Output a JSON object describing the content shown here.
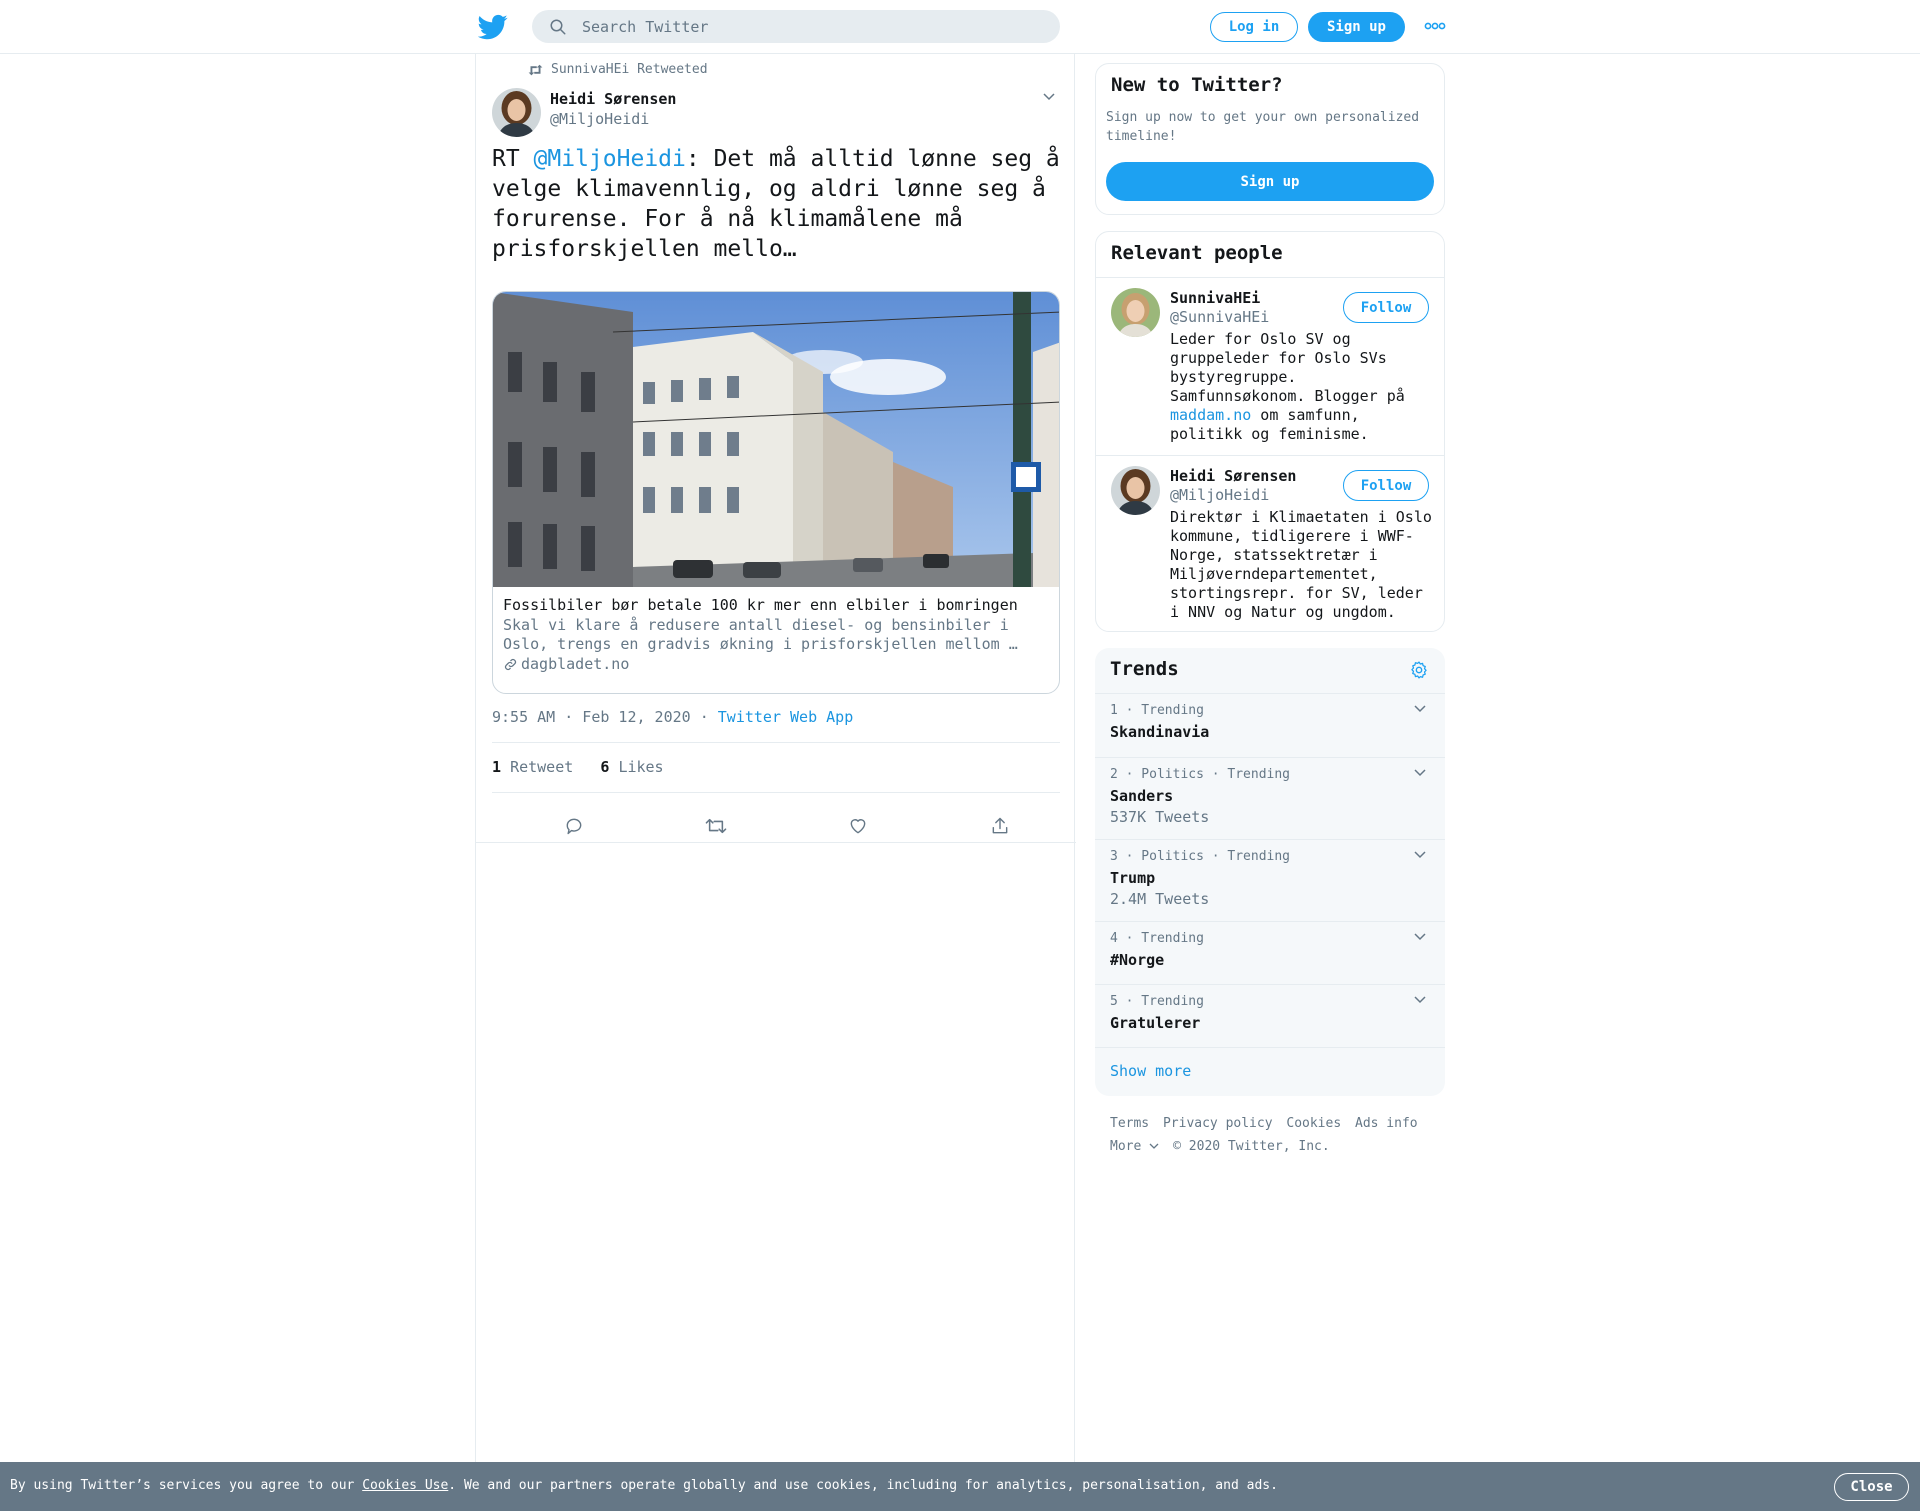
{
  "header": {
    "search_placeholder": "Search Twitter",
    "login_label": "Log in",
    "signup_label": "Sign up"
  },
  "tweet": {
    "retweeted_by": "SunnivaHEi Retweeted",
    "author_name": "Heidi Sørensen",
    "author_handle": "@MiljoHeidi",
    "text_prefix": "RT ",
    "mention": "@MiljoHeidi",
    "text_body": ": Det må alltid lønne seg å velge klimavennlig, og aldri lønne seg å forurense. For å nå klimamålene må prisforskjellen mello…",
    "card": {
      "title": "Fossilbiler bør betale 100 kr mer enn elbiler i bomringen",
      "description": "Skal vi klare å redusere antall diesel- og bensinbiler i Oslo, trengs en gradvis økning i prisforskjellen mellom …",
      "domain": "dagbladet.no"
    },
    "time": "9:55 AM · Feb 12, 2020",
    "separator": " · ",
    "source": "Twitter Web App",
    "retweet_count": "1",
    "retweet_label": "Retweet",
    "like_count": "6",
    "like_label": "Likes"
  },
  "new_to_twitter": {
    "title": "New to Twitter?",
    "subtitle": "Sign up now to get your own personalized timeline!",
    "signup_label": "Sign up"
  },
  "relevant_people": {
    "title": "Relevant people",
    "people": [
      {
        "name": "SunnivaHEi",
        "handle": "@SunnivaHEi",
        "follow_label": "Follow",
        "bio_pre": "Leder for Oslo SV og gruppeleder for Oslo SVs bystyregruppe. Samfunnsøkonom. Blogger på ",
        "bio_link": "maddam.no",
        "bio_post": " om samfunn, politikk og feminisme."
      },
      {
        "name": "Heidi Sørensen",
        "handle": "@MiljoHeidi",
        "follow_label": "Follow",
        "bio": "Direktør i Klimaetaten i Oslo kommune, tidligerere i WWF-Norge, statssektretær i Miljøverndepartementet, stortingsrepr. for SV, leder i NNV og Natur og ungdom."
      }
    ]
  },
  "trends": {
    "title": "Trends",
    "items": [
      {
        "meta": "1 · Trending",
        "name": "Skandinavia",
        "count": ""
      },
      {
        "meta": "2 · Politics · Trending",
        "name": "Sanders",
        "count": "537K Tweets"
      },
      {
        "meta": "3 · Politics · Trending",
        "name": "Trump",
        "count": "2.4M Tweets"
      },
      {
        "meta": "4 · Trending",
        "name": "#Norge",
        "count": ""
      },
      {
        "meta": "5 · Trending",
        "name": "Gratulerer",
        "count": ""
      }
    ],
    "show_more": "Show more"
  },
  "footer": {
    "links": [
      "Terms",
      "Privacy policy",
      "Cookies",
      "Ads info"
    ],
    "more": "More",
    "copyright": "© 2020 Twitter, Inc."
  },
  "cookie_bar": {
    "text_pre": "By using Twitter’s services you agree to our ",
    "link": "Cookies Use",
    "text_post": ". We and our partners operate globally and use cookies, including for analytics, personalisation, and ads.",
    "close_label": "Close"
  },
  "colors": {
    "brand": "#1da1f2",
    "link": "#1b95e0",
    "secondary_text": "#657786",
    "cookie_bar": "#657786"
  },
  "icons": {
    "logo": "twitter-bird-icon",
    "search": "search-icon",
    "more": "more-dots-icon",
    "retweet_small": "retweet-icon",
    "chevron": "chevron-down-icon",
    "link": "link-icon",
    "reply": "reply-icon",
    "retweet": "retweet-icon",
    "like": "heart-icon",
    "share": "share-icon",
    "settings": "gear-icon"
  }
}
